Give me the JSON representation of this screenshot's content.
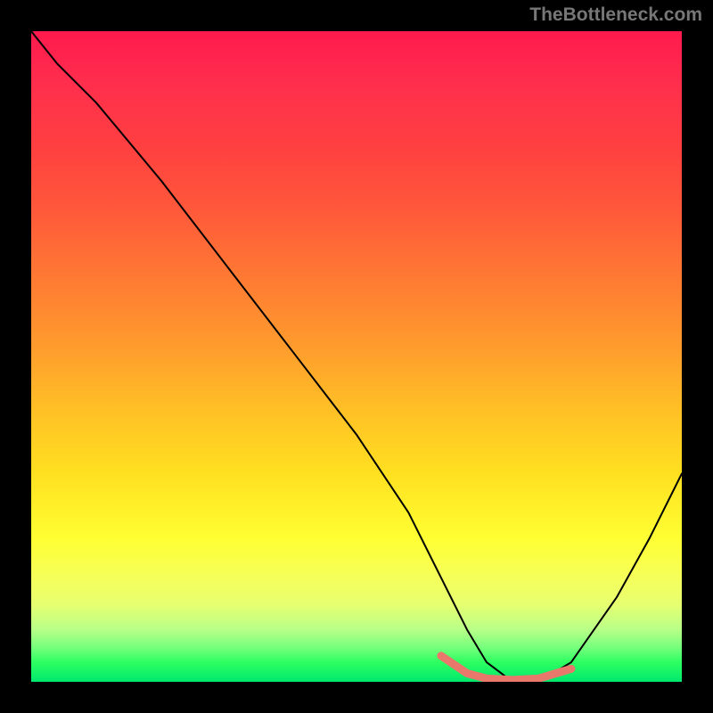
{
  "watermark": "TheBottleneck.com",
  "chart_data": {
    "type": "line",
    "title": "",
    "xlabel": "",
    "ylabel": "",
    "xlim": [
      0,
      100
    ],
    "ylim": [
      0,
      100
    ],
    "grid": false,
    "legend": false,
    "background_gradient": {
      "orientation": "vertical",
      "stops": [
        {
          "pct": 0,
          "color": "#ff1a4d"
        },
        {
          "pct": 50,
          "color": "#ffb030"
        },
        {
          "pct": 80,
          "color": "#ffff40"
        },
        {
          "pct": 100,
          "color": "#00e86e"
        }
      ]
    },
    "series": [
      {
        "name": "curve",
        "x": [
          0,
          4,
          10,
          20,
          30,
          40,
          50,
          58,
          63,
          67,
          70,
          74,
          78,
          83,
          90,
          95,
          100
        ],
        "values": [
          100,
          95,
          89,
          77,
          64,
          51,
          38,
          26,
          16,
          8,
          3,
          0,
          0,
          3,
          13,
          22,
          32
        ],
        "color": "#000000"
      },
      {
        "name": "highlight-segment",
        "x": [
          63,
          67,
          70,
          74,
          78,
          83
        ],
        "values": [
          4.0,
          1.3,
          0.5,
          0.3,
          0.5,
          2.0
        ],
        "color": "#e8786c",
        "stroke_width_px": 9
      }
    ],
    "annotations": []
  }
}
